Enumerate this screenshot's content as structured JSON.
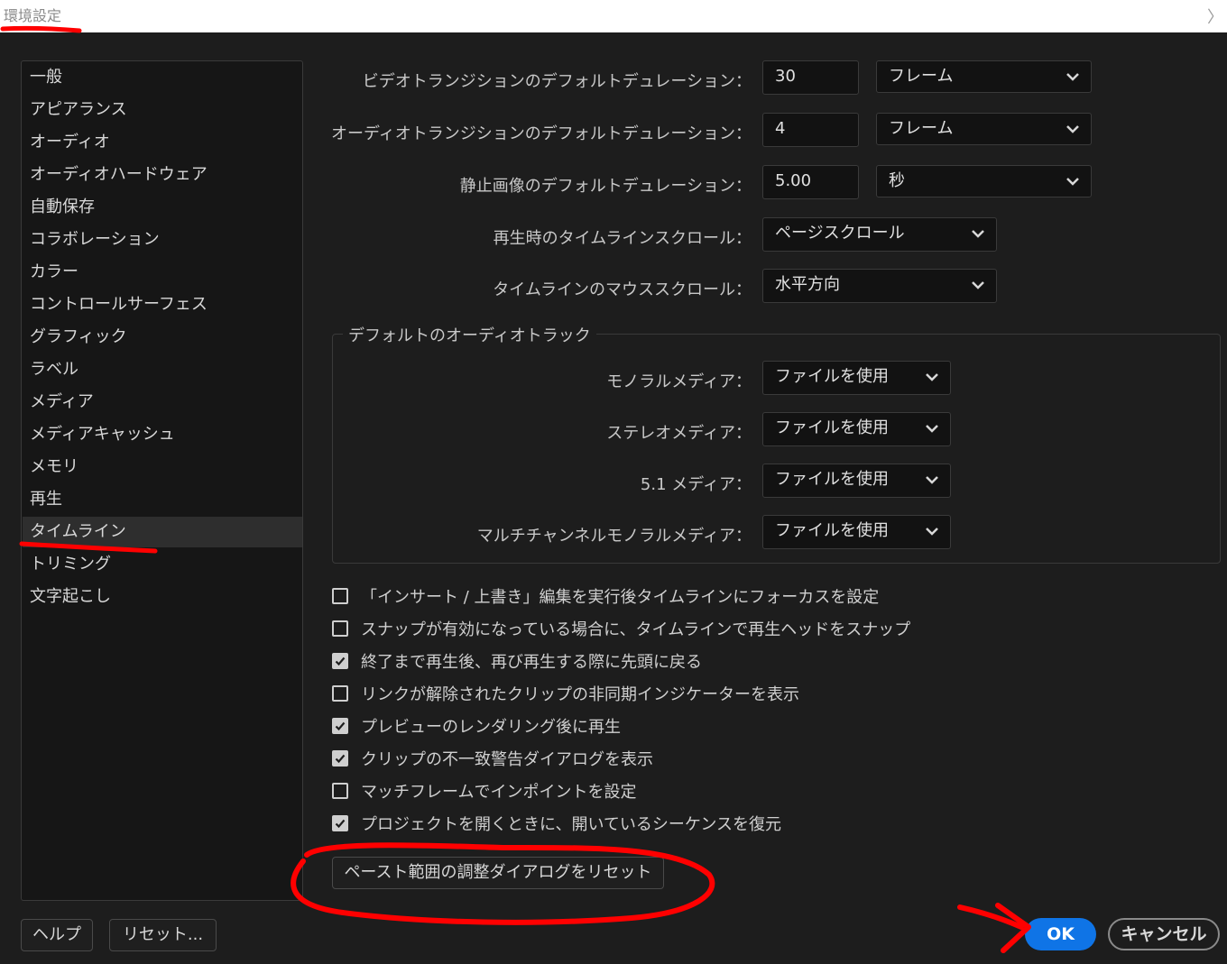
{
  "window": {
    "title": "環境設定",
    "collapse_icon": "chevron-right-icon"
  },
  "sidebar": {
    "items": [
      {
        "label": "一般"
      },
      {
        "label": "アピアランス"
      },
      {
        "label": "オーディオ"
      },
      {
        "label": "オーディオハードウェア"
      },
      {
        "label": "自動保存"
      },
      {
        "label": "コラボレーション"
      },
      {
        "label": "カラー"
      },
      {
        "label": "コントロールサーフェス"
      },
      {
        "label": "グラフィック"
      },
      {
        "label": "ラベル"
      },
      {
        "label": "メディア"
      },
      {
        "label": "メディアキャッシュ"
      },
      {
        "label": "メモリ"
      },
      {
        "label": "再生"
      },
      {
        "label": "タイムライン",
        "selected": true
      },
      {
        "label": "トリミング"
      },
      {
        "label": "文字起こし"
      }
    ]
  },
  "settings": {
    "video_transition": {
      "label": "ビデオトランジションのデフォルトデュレーション：",
      "value": "30",
      "unit": "フレーム"
    },
    "audio_transition": {
      "label": "オーディオトランジションのデフォルトデュレーション：",
      "value": "4",
      "unit": "フレーム"
    },
    "still_image": {
      "label": "静止画像のデフォルトデュレーション：",
      "value": "5.00",
      "unit": "秒"
    },
    "playback_scroll": {
      "label": "再生時のタイムラインスクロール：",
      "value": "ページスクロール"
    },
    "mouse_scroll": {
      "label": "タイムラインのマウススクロール：",
      "value": "水平方向"
    }
  },
  "audio_tracks": {
    "title": "デフォルトのオーディオトラック",
    "mono": {
      "label": "モノラルメディア：",
      "value": "ファイルを使用"
    },
    "stereo": {
      "label": "ステレオメディア：",
      "value": "ファイルを使用"
    },
    "surround": {
      "label": "5.1 メディア：",
      "value": "ファイルを使用"
    },
    "multichannel": {
      "label": "マルチチャンネルモノラルメディア：",
      "value": "ファイルを使用"
    }
  },
  "checkboxes": [
    {
      "label": "「インサート / 上書き」編集を実行後タイムラインにフォーカスを設定",
      "checked": false
    },
    {
      "label": "スナップが有効になっている場合に、タイムラインで再生ヘッドをスナップ",
      "checked": false
    },
    {
      "label": "終了まで再生後、再び再生する際に先頭に戻る",
      "checked": true
    },
    {
      "label": "リンクが解除されたクリップの非同期インジケーターを表示",
      "checked": false
    },
    {
      "label": "プレビューのレンダリング後に再生",
      "checked": true
    },
    {
      "label": "クリップの不一致警告ダイアログを表示",
      "checked": true
    },
    {
      "label": "マッチフレームでインポイントを設定",
      "checked": false
    },
    {
      "label": "プロジェクトを開くときに、開いているシーケンスを復元",
      "checked": true
    }
  ],
  "buttons": {
    "reset_paste": "ペースト範囲の調整ダイアログをリセット",
    "help": "ヘルプ",
    "reset": "リセット...",
    "ok": "OK",
    "cancel": "キャンセル"
  },
  "colors": {
    "accent": "#0f74e6",
    "annotation": "#ff0000",
    "background": "#1d1d1d"
  }
}
